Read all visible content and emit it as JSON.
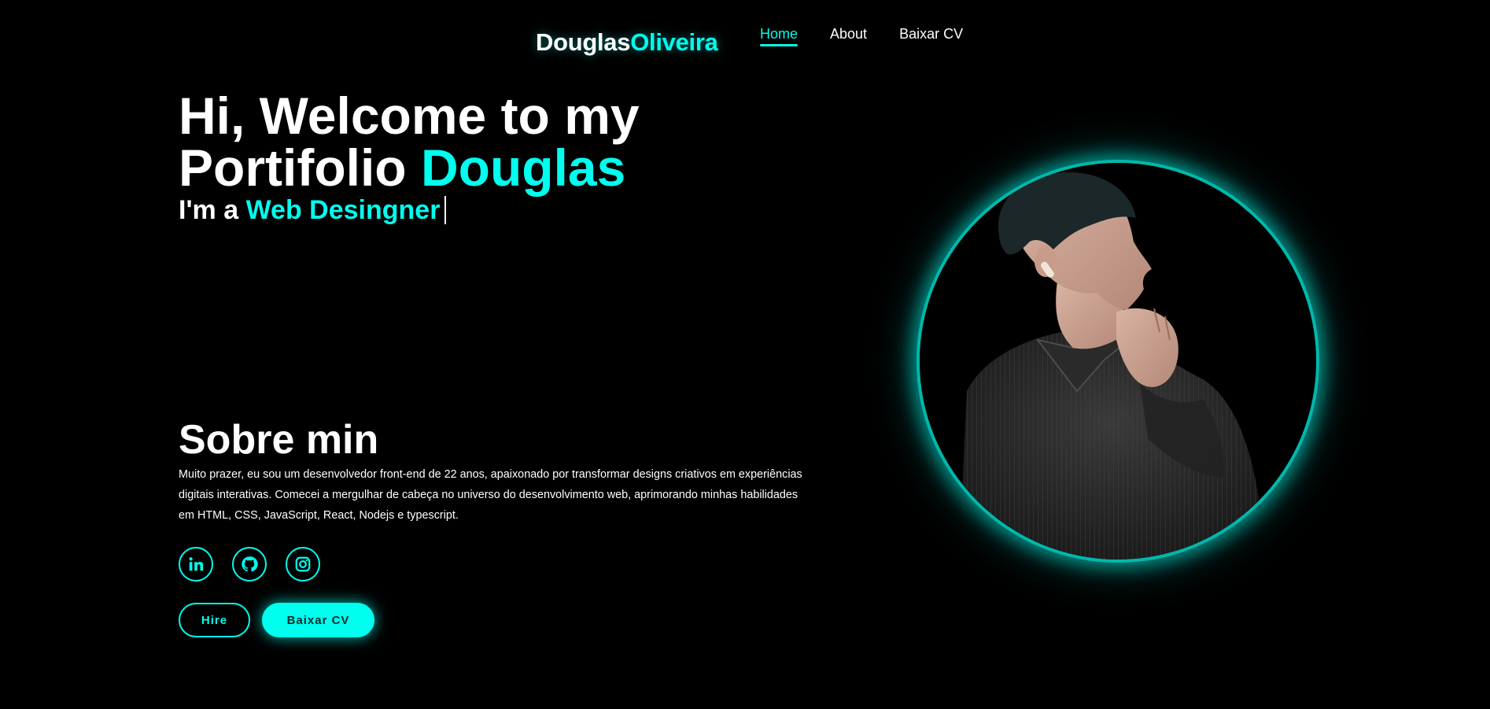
{
  "header": {
    "logo_first": "Douglas",
    "logo_last": "Oliveira",
    "nav": [
      {
        "label": "Home",
        "active": true
      },
      {
        "label": "About",
        "active": false
      },
      {
        "label": "Baixar CV",
        "active": false
      }
    ]
  },
  "hero": {
    "title_line1": "Hi, Welcome to my",
    "title_line2_prefix": "Portifolio ",
    "title_name": "Douglas",
    "subtitle_prefix": "I'm a ",
    "subtitle_role": "Web Desingner"
  },
  "about": {
    "heading": "Sobre min",
    "text": "Muito prazer, eu sou um desenvolvedor front-end de 22 anos, apaixonado por transformar designs criativos em experiências digitais interativas. Comecei a mergulhar de cabeça no universo do desenvolvimento web, aprimorando minhas habilidades em HTML, CSS, JavaScript, React, Nodejs e typescript."
  },
  "socials": [
    {
      "icon": "linkedin-icon"
    },
    {
      "icon": "github-icon"
    },
    {
      "icon": "instagram-icon"
    }
  ],
  "buttons": {
    "hire": "Hire",
    "cv": "Baixar CV"
  },
  "colors": {
    "accent": "#00ffee",
    "background": "#000000",
    "text": "#ffffff"
  }
}
